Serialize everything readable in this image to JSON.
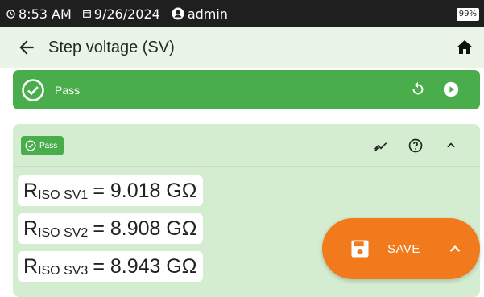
{
  "status_bar": {
    "time": "8:53 AM",
    "date": "9/26/2024",
    "user": "admin",
    "battery": "99%"
  },
  "app_bar": {
    "title": "Step voltage (SV)"
  },
  "pass_bar": {
    "label": "Pass"
  },
  "card": {
    "badge": "Pass",
    "results": [
      {
        "symbol": "R",
        "subscript": "ISO SV1",
        "value": "= 9.018 GΩ"
      },
      {
        "symbol": "R",
        "subscript": "ISO SV2",
        "value": "= 8.908 GΩ"
      },
      {
        "symbol": "R",
        "subscript": "ISO SV3",
        "value": "= 8.943 GΩ"
      }
    ]
  },
  "save_button": {
    "label": "SAVE"
  },
  "colors": {
    "status_bar": "#1f1f1f",
    "app_bar": "#eaf5e8",
    "pass_green": "#48ad4a",
    "card_bg": "#d4ecd0",
    "save_orange": "#f07a1c"
  }
}
